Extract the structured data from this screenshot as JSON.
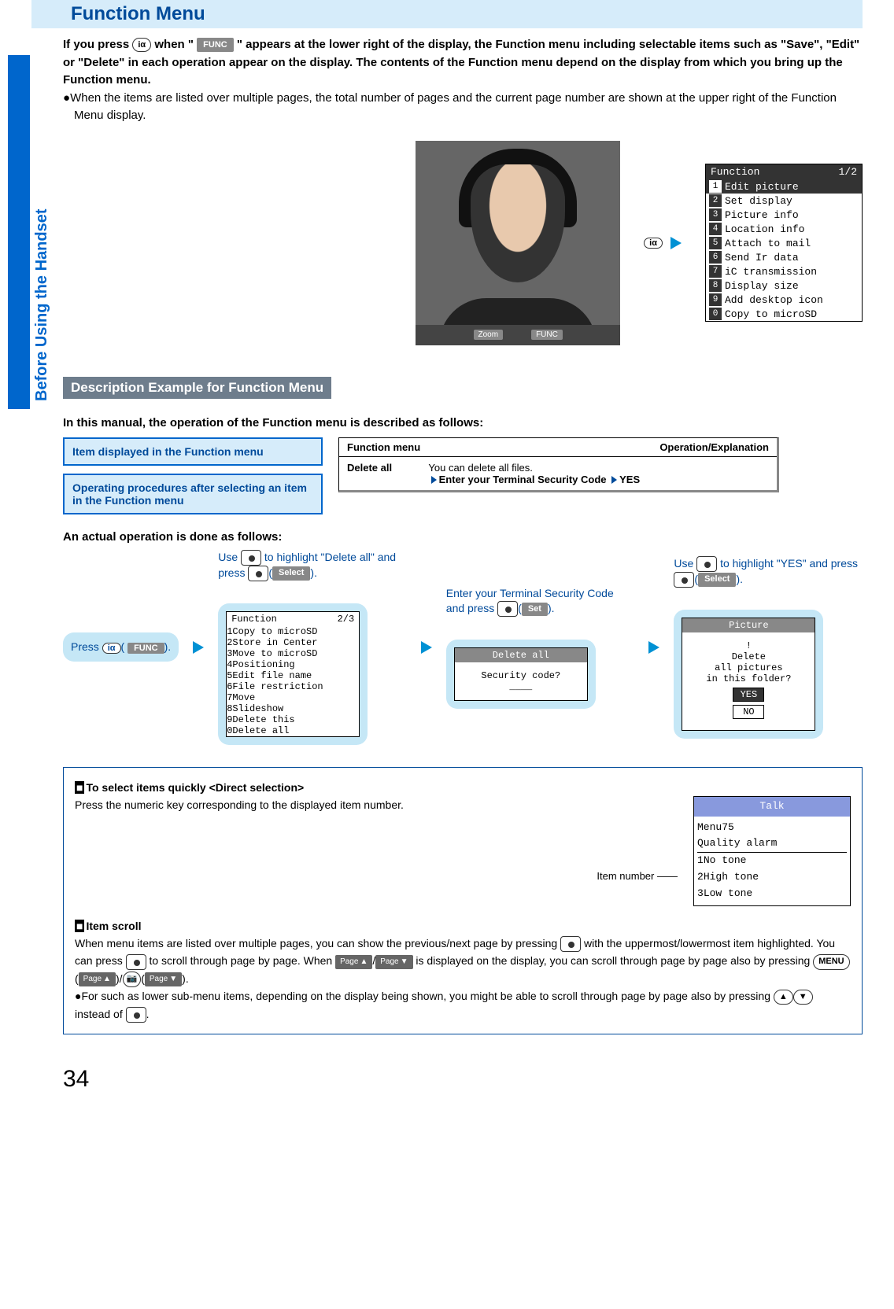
{
  "sidebar": {
    "label": "Before Using the Handset"
  },
  "header": {
    "title": "Function Menu"
  },
  "intro": {
    "line1a": "If you press ",
    "line1b": " when \"",
    "line1c": "\" appears at the lower right of the display, the Function menu including selectable items such as \"Save\", \"Edit\" or \"Delete\" in each operation appear on the display. The contents of the Function menu depend on the display from which you bring up the Function menu.",
    "bullet1": "When the items are listed over multiple pages, the total number of pages and the current page number are shown at the upper right of the Function Menu display.",
    "func_chip": "FUNC",
    "key_label": "iα"
  },
  "photo_bar": {
    "zoom": "Zoom",
    "func": "FUNC"
  },
  "phone1": {
    "title": "Function",
    "page": "1/2",
    "items": [
      "Edit picture",
      "Set display",
      "Picture info",
      "Location info",
      "Attach to mail",
      "Send Ir data",
      "iC transmission",
      "Display size",
      "Add desktop icon",
      "Copy to microSD"
    ],
    "highlight": 0
  },
  "subheader1": "Description Example for Function Menu",
  "desc_intro": "In this manual, the operation of the Function menu is described as follows:",
  "legend": {
    "box1": "Item displayed in the Function menu",
    "box2": "Operating procedures after selecting an item in the Function menu"
  },
  "fm_table": {
    "h1": "Function menu",
    "h2": "Operation/Explanation",
    "row_item": "Delete all",
    "row_expl": "You can delete all files.",
    "row_proc": "Enter your Terminal Security Code",
    "row_yes": "YES"
  },
  "actual_intro": "An actual operation is done as follows:",
  "flow": {
    "step0": {
      "text_a": "Press ",
      "chip": "FUNC"
    },
    "step1": {
      "line1": "Use ",
      "line2": " to highlight \"Delete all\" and press ",
      "chip": "Select"
    },
    "step2": {
      "line1": "Enter your Terminal Security Code and press ",
      "chip": "Set"
    },
    "step3": {
      "line1": "Use ",
      "line2": " to highlight \"YES\" and press ",
      "chip": "Select"
    }
  },
  "mini1": {
    "title": "Function",
    "page": "2/3",
    "items": [
      "Copy to microSD",
      "Store in Center",
      "Move to microSD",
      "Positioning",
      "Edit file name",
      "File restriction",
      "Move",
      "Slideshow",
      "Delete this",
      "Delete all"
    ],
    "highlight": 9
  },
  "mini2": {
    "title": "Delete all",
    "body": "Security code?",
    "blank": "____"
  },
  "mini3": {
    "title": "Picture",
    "body1": "Delete",
    "body2": "all pictures",
    "body3": "in this folder?",
    "yes": "YES",
    "no": "NO"
  },
  "notes": {
    "h1": "To select items quickly <Direct selection>",
    "p1": "Press the numeric key corresponding to the displayed item number.",
    "itemno_label": "Item number",
    "h2": "Item scroll",
    "p2a": "When menu items are listed over multiple pages, you can show the previous/next page by pressing ",
    "p2b": " with the uppermost/lowermost item highlighted. You can press ",
    "p2c": " to scroll through page by page. When ",
    "p2d": " is displayed on the display, you can scroll through page by page also by pressing ",
    "p2e": ".",
    "bullet": "For such as lower sub-menu items, depending on the display being shown, you might be able to scroll through page by page also by pressing ",
    "bullet_end": " instead of ",
    "page_up": "Page",
    "page_dn": "Page",
    "menu_key": "MENU"
  },
  "talk": {
    "title": "Talk",
    "menu": "Menu75",
    "sub": "Quality alarm",
    "items": [
      "No tone",
      "High tone",
      "Low tone"
    ],
    "highlight": 1
  },
  "page_number": "34"
}
